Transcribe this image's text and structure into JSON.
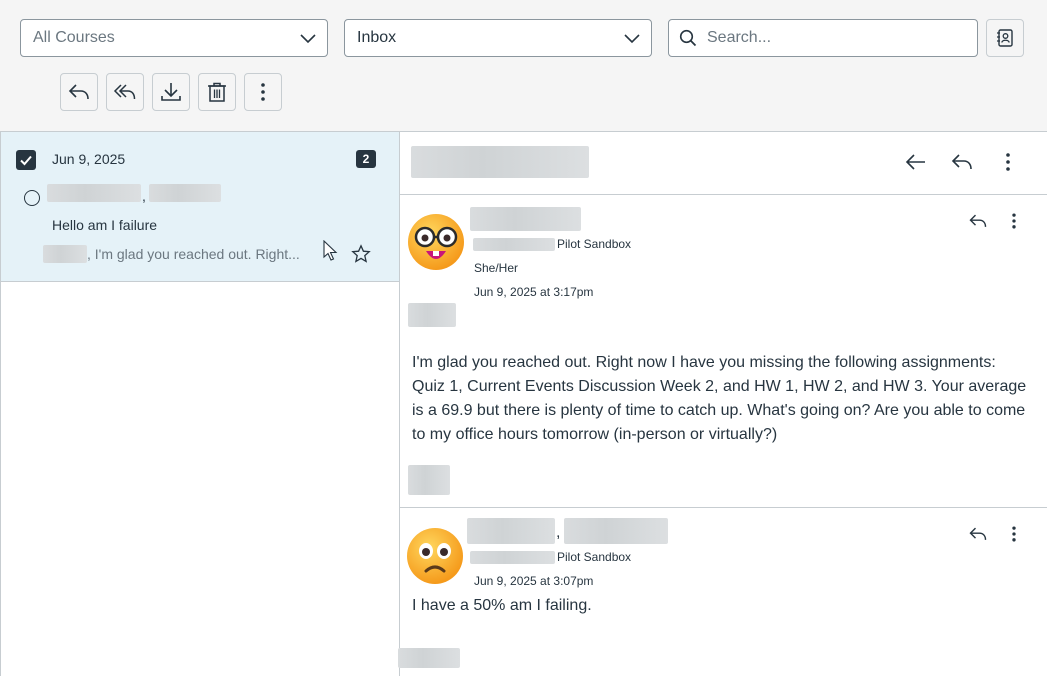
{
  "filters": {
    "course_select": "All Courses",
    "mailbox_select": "Inbox",
    "search_placeholder": "Search..."
  },
  "toolbar": {
    "icons": [
      "reply-icon",
      "reply-all-icon",
      "download-icon",
      "trash-icon",
      "more-vertical-icon"
    ]
  },
  "conversation_list": {
    "items": [
      {
        "date": "Jun 9, 2025",
        "count": "2",
        "participants_separator": ",",
        "subject": "Hello am I failure",
        "preview": ", I'm glad you reached out. Right...",
        "selected": true
      }
    ]
  },
  "messages": [
    {
      "course": "Pilot Sandbox",
      "pronouns": "She/Her",
      "timestamp": "Jun 9, 2025 at 3:17pm",
      "body": "I'm glad you reached out. Right now I have you missing the following assignments: Quiz 1, Current Events Discussion Week 2, and HW 1, HW 2, and HW 3. Your average is a 69.9 but there is plenty of time to catch up. What's going on? Are you able to come to my office hours tomorrow (in-person or virtually?)"
    },
    {
      "course": "Pilot Sandbox",
      "name_separator": ",",
      "timestamp": "Jun 9, 2025 at 3:07pm",
      "body": "I have a 50% am I failing."
    }
  ],
  "colors": {
    "selected_row": "#e5f2f8",
    "text": "#273540",
    "muted": "#6b7780",
    "border": "#c7cdd1"
  }
}
